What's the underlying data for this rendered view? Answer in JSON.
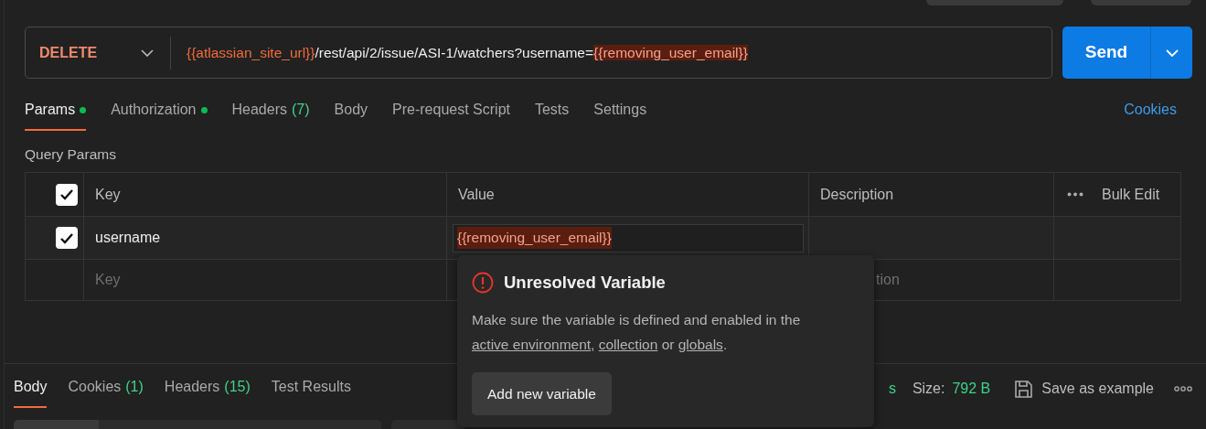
{
  "request": {
    "method": "DELETE",
    "url_parts": [
      {
        "kind": "variable",
        "text": "{{atlassian_site_url}}",
        "resolved": true
      },
      {
        "kind": "text",
        "text": "/rest/api/2/issue/ASI-1/watchers?username="
      },
      {
        "kind": "variable",
        "text": "{{removing_user_email}}",
        "resolved": false
      }
    ],
    "send_label": "Send"
  },
  "request_tabs": [
    {
      "label": "Params",
      "dot": true,
      "selected": true
    },
    {
      "label": "Authorization",
      "dot": true,
      "selected": false
    },
    {
      "label": "Headers",
      "count": "(7)",
      "selected": false
    },
    {
      "label": "Body",
      "selected": false
    },
    {
      "label": "Pre-request Script",
      "selected": false
    },
    {
      "label": "Tests",
      "selected": false
    },
    {
      "label": "Settings",
      "selected": false
    }
  ],
  "cookies_link": "Cookies",
  "query_params": {
    "title": "Query Params",
    "header": {
      "checked": true,
      "key": "Key",
      "value": "Value",
      "description": "Description",
      "bulk_edit": "Bulk Edit"
    },
    "rows": [
      {
        "checked": true,
        "key": "username",
        "value": "{{removing_user_email}}",
        "value_resolved": false
      }
    ],
    "new_row": {
      "key_placeholder": "Key",
      "description_visible": "tion"
    }
  },
  "popover": {
    "title": "Unresolved Variable",
    "message": [
      {
        "kind": "text",
        "text": "Make sure the variable is defined and enabled in the "
      },
      {
        "kind": "link",
        "text": "active environment"
      },
      {
        "kind": "text",
        "text": ", "
      },
      {
        "kind": "link",
        "text": "collection"
      },
      {
        "kind": "text",
        "text": " or "
      },
      {
        "kind": "link",
        "text": "globals"
      },
      {
        "kind": "text",
        "text": "."
      }
    ],
    "button": "Add new variable"
  },
  "response_tabs": [
    {
      "label": "Body",
      "selected": true
    },
    {
      "label": "Cookies",
      "count": "(1)",
      "selected": false
    },
    {
      "label": "Headers",
      "count": "(15)",
      "selected": false
    },
    {
      "label": "Test Results",
      "selected": false
    }
  ],
  "response_meta": {
    "time_fragment": "s",
    "size_label": "Size:",
    "size_value": "792 B",
    "save_label": "Save as example"
  }
}
